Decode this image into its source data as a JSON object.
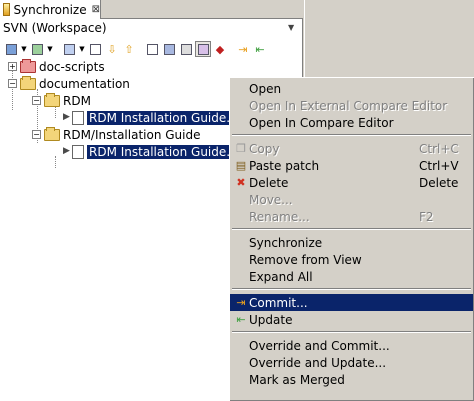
{
  "view": {
    "tab_title": "Synchronize",
    "close_glyph": "⊠",
    "subtitle": "SVN (Workspace)",
    "menu_glyph": "▼"
  },
  "toolbar": {
    "icons": [
      "pin-icon",
      "dropdown-icon",
      "sync-icon",
      "dropdown-icon",
      "layout-icon",
      "dropdown-icon",
      "collapse-icon",
      "down-arrow-icon",
      "up-arrow-icon",
      "expand-all-icon",
      "link-icon",
      "incoming-icon",
      "outgoing-mode-icon",
      "remove-icon",
      "commit-icon",
      "update-icon"
    ]
  },
  "tree": {
    "items": [
      {
        "label": "doc-scripts"
      },
      {
        "label": "documentation"
      },
      {
        "label": "RDM"
      },
      {
        "label": "RDM Installation Guide.pdf"
      },
      {
        "label": "RDM/Installation Guide"
      },
      {
        "label": "RDM Installation Guide.docx"
      }
    ],
    "expand_plus": "+",
    "expand_minus": "−"
  },
  "context_menu": {
    "items": [
      {
        "label": "Open",
        "accel": "",
        "disabled": false
      },
      {
        "label": "Open In External Compare Editor",
        "accel": "",
        "disabled": true
      },
      {
        "label": "Open In Compare Editor",
        "accel": "",
        "disabled": false
      },
      {
        "label": "Copy",
        "accel": "Ctrl+C",
        "disabled": true
      },
      {
        "label": "Paste patch",
        "accel": "Ctrl+V",
        "disabled": false
      },
      {
        "label": "Delete",
        "accel": "Delete",
        "disabled": false
      },
      {
        "label": "Move...",
        "accel": "",
        "disabled": true
      },
      {
        "label": "Rename...",
        "accel": "F2",
        "disabled": true
      },
      {
        "label": "Synchronize",
        "accel": "",
        "disabled": false
      },
      {
        "label": "Remove from View",
        "accel": "",
        "disabled": false
      },
      {
        "label": "Expand All",
        "accel": "",
        "disabled": false
      },
      {
        "label": "Commit...",
        "accel": "",
        "disabled": false,
        "highlighted": true
      },
      {
        "label": "Update",
        "accel": "",
        "disabled": false
      },
      {
        "label": "Override and Commit...",
        "accel": "",
        "disabled": false
      },
      {
        "label": "Override and Update...",
        "accel": "",
        "disabled": false
      },
      {
        "label": "Mark as Merged",
        "accel": "",
        "disabled": false
      }
    ],
    "colors": {
      "highlight": "#0a246a",
      "delete_icon": "#d03020",
      "commit_icon": "#e8a020",
      "update_icon": "#40a040"
    }
  }
}
